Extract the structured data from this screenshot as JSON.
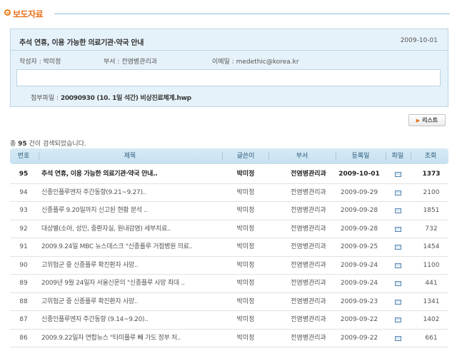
{
  "section": {
    "title": "보도자료"
  },
  "detail": {
    "title": "추석 연휴, 이용 가능한 의료기관·약국 안내",
    "date": "2009-10-01",
    "author_label": "작성자 : ",
    "author": "박미정",
    "dept_label": "부서 : ",
    "dept": "전염병관리과",
    "email_label": "이메일 : ",
    "email": "medethic@korea.kr",
    "attach_label": "첨부파일 : ",
    "attach_file": "20090930 (10. 1일 석간) 비상진료체계.hwp"
  },
  "list_button": {
    "label": "리스트"
  },
  "result": {
    "prefix": "총 ",
    "count": "95",
    "suffix": " 건이 검색되었습니다."
  },
  "table": {
    "columns": [
      "번호",
      "제목",
      "글쓴이",
      "부서",
      "등록일",
      "파일",
      "조회"
    ],
    "rows": [
      {
        "no": "95",
        "title": "추석 연휴, 이용 가능한 의료기관·약국 안내..",
        "author": "박미정",
        "dept": "전염병관리과",
        "date": "2009-10-01",
        "views": "1373"
      },
      {
        "no": "94",
        "title": "신종인플루엔자 주간동향(9.21~9.27)..",
        "author": "박미정",
        "dept": "전염병관리과",
        "date": "2009-09-29",
        "views": "2100"
      },
      {
        "no": "93",
        "title": "신종플루 9.20일까지 신고된 현황 분석 ..",
        "author": "박미정",
        "dept": "전염병관리과",
        "date": "2009-09-28",
        "views": "1851"
      },
      {
        "no": "92",
        "title": "대상별(소아, 성인, 중환자실, 원내감염) 세부치료..",
        "author": "박미정",
        "dept": "전염병관리과",
        "date": "2009-09-28",
        "views": "732"
      },
      {
        "no": "91",
        "title": "2009.9.24일 MBC 뉴스데스크 \"신종플루 거점병원 의료..",
        "author": "박미정",
        "dept": "전염병관리과",
        "date": "2009-09-25",
        "views": "1454"
      },
      {
        "no": "90",
        "title": "고위험군 중 신종플루 확진환자 사망..",
        "author": "박미정",
        "dept": "전염병관리과",
        "date": "2009-09-24",
        "views": "1100"
      },
      {
        "no": "89",
        "title": "2009년 9월 24일자 서울신문의 \"신종플루 사망 최대 ..",
        "author": "박미정",
        "dept": "전염병관리과",
        "date": "2009-09-24",
        "views": "441"
      },
      {
        "no": "88",
        "title": "고위험군 중 신종플루 확진환자 사망..",
        "author": "박미정",
        "dept": "전염병관리과",
        "date": "2009-09-23",
        "views": "1341"
      },
      {
        "no": "87",
        "title": "신종인플루엔자 주간동향 (9.14~9.20)..",
        "author": "박미정",
        "dept": "전염병관리과",
        "date": "2009-09-22",
        "views": "1402"
      },
      {
        "no": "86",
        "title": "2009.9.22일자 연합뉴스 \"타미플루 빼 가도 정부 처..",
        "author": "박미정",
        "dept": "전염병관리과",
        "date": "2009-09-22",
        "views": "661"
      }
    ]
  }
}
